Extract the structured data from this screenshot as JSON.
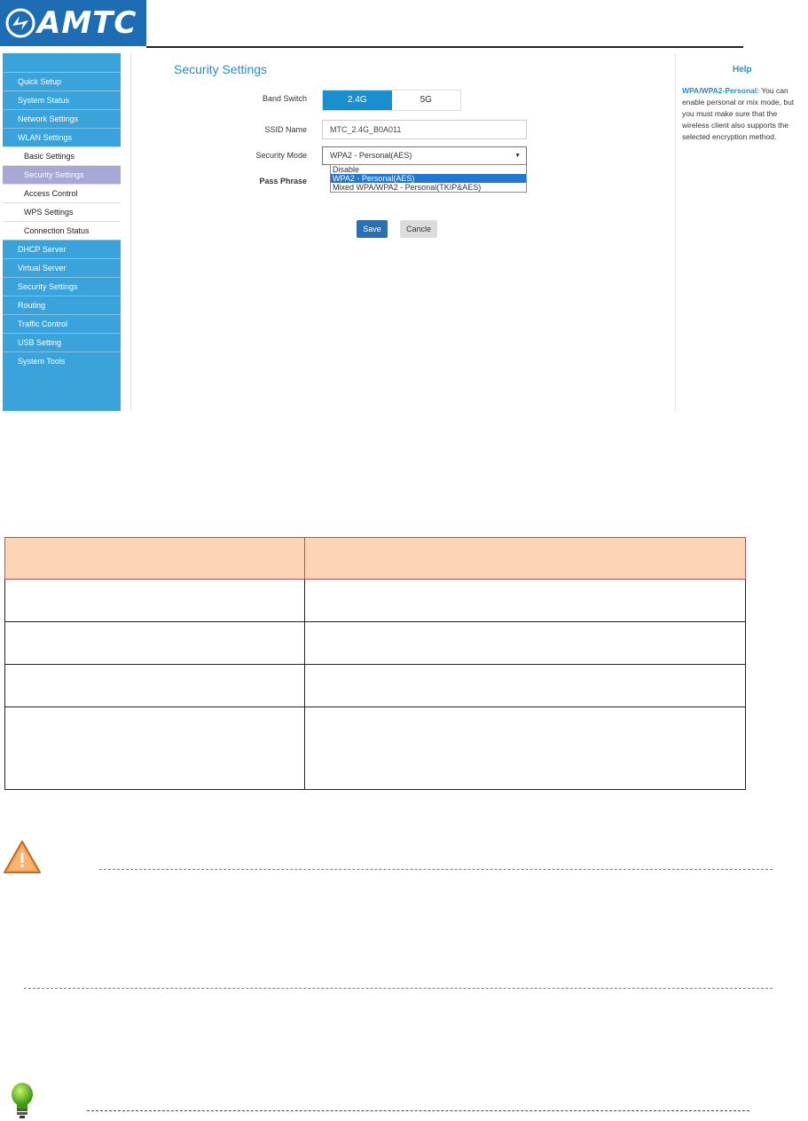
{
  "logo": {
    "text": "AMTC"
  },
  "sidebar": {
    "items": [
      {
        "label": "Quick Setup",
        "type": "main",
        "active": false
      },
      {
        "label": "System Status",
        "type": "main",
        "active": false
      },
      {
        "label": "Network Settings",
        "type": "main",
        "active": false
      },
      {
        "label": "WLAN Settings",
        "type": "main",
        "active": false
      },
      {
        "label": "Basic Settings",
        "type": "sub",
        "active": false
      },
      {
        "label": "Security Settings",
        "type": "sub",
        "active": true
      },
      {
        "label": "Access Control",
        "type": "sub",
        "active": false
      },
      {
        "label": "WPS Settings",
        "type": "sub",
        "active": false
      },
      {
        "label": "Connection Status",
        "type": "sub",
        "active": false
      },
      {
        "label": "DHCP Server",
        "type": "main",
        "active": false
      },
      {
        "label": "Virtual Server",
        "type": "main",
        "active": false
      },
      {
        "label": "Security Settings",
        "type": "main",
        "active": false
      },
      {
        "label": "Routing",
        "type": "main",
        "active": false
      },
      {
        "label": "Traffic Control",
        "type": "main",
        "active": false
      },
      {
        "label": "USB Setting",
        "type": "main",
        "active": false
      },
      {
        "label": "System Tools",
        "type": "main",
        "active": false
      }
    ]
  },
  "main": {
    "title": "Security Settings",
    "band_switch": {
      "label": "Band Switch",
      "options": [
        "2.4G",
        "5G"
      ],
      "selected": "2.4G"
    },
    "ssid": {
      "label": "SSID Name",
      "value": "MTC_2.4G_B0A011"
    },
    "security_mode": {
      "label": "Security Mode",
      "value": "WPA2 - Personal(AES)",
      "options": [
        "Disable",
        "WPA2 - Personal(AES)",
        "Mixed WPA/WPA2 - Personal(TKIP&AES)"
      ],
      "highlighted": "WPA2 - Personal(AES)"
    },
    "pass_phrase": {
      "label": "Pass Phrase"
    },
    "save_label": "Save",
    "cancel_label": "Cancle"
  },
  "help": {
    "title": "Help",
    "term": "WPA/WPA2-Personal:",
    "text": " You can enable personal or mix mode, but you must make sure that the wireless client also supports the selected encryption method."
  },
  "colors": {
    "brand": "#1d6db5",
    "sidebar": "#3aa3dc",
    "accent": "#1a8fd0",
    "active_sub": "#a7a8d6",
    "table_header": "#fbd5b5"
  },
  "icons": {
    "warning": "warning-triangle-icon",
    "tip": "lightbulb-icon"
  }
}
